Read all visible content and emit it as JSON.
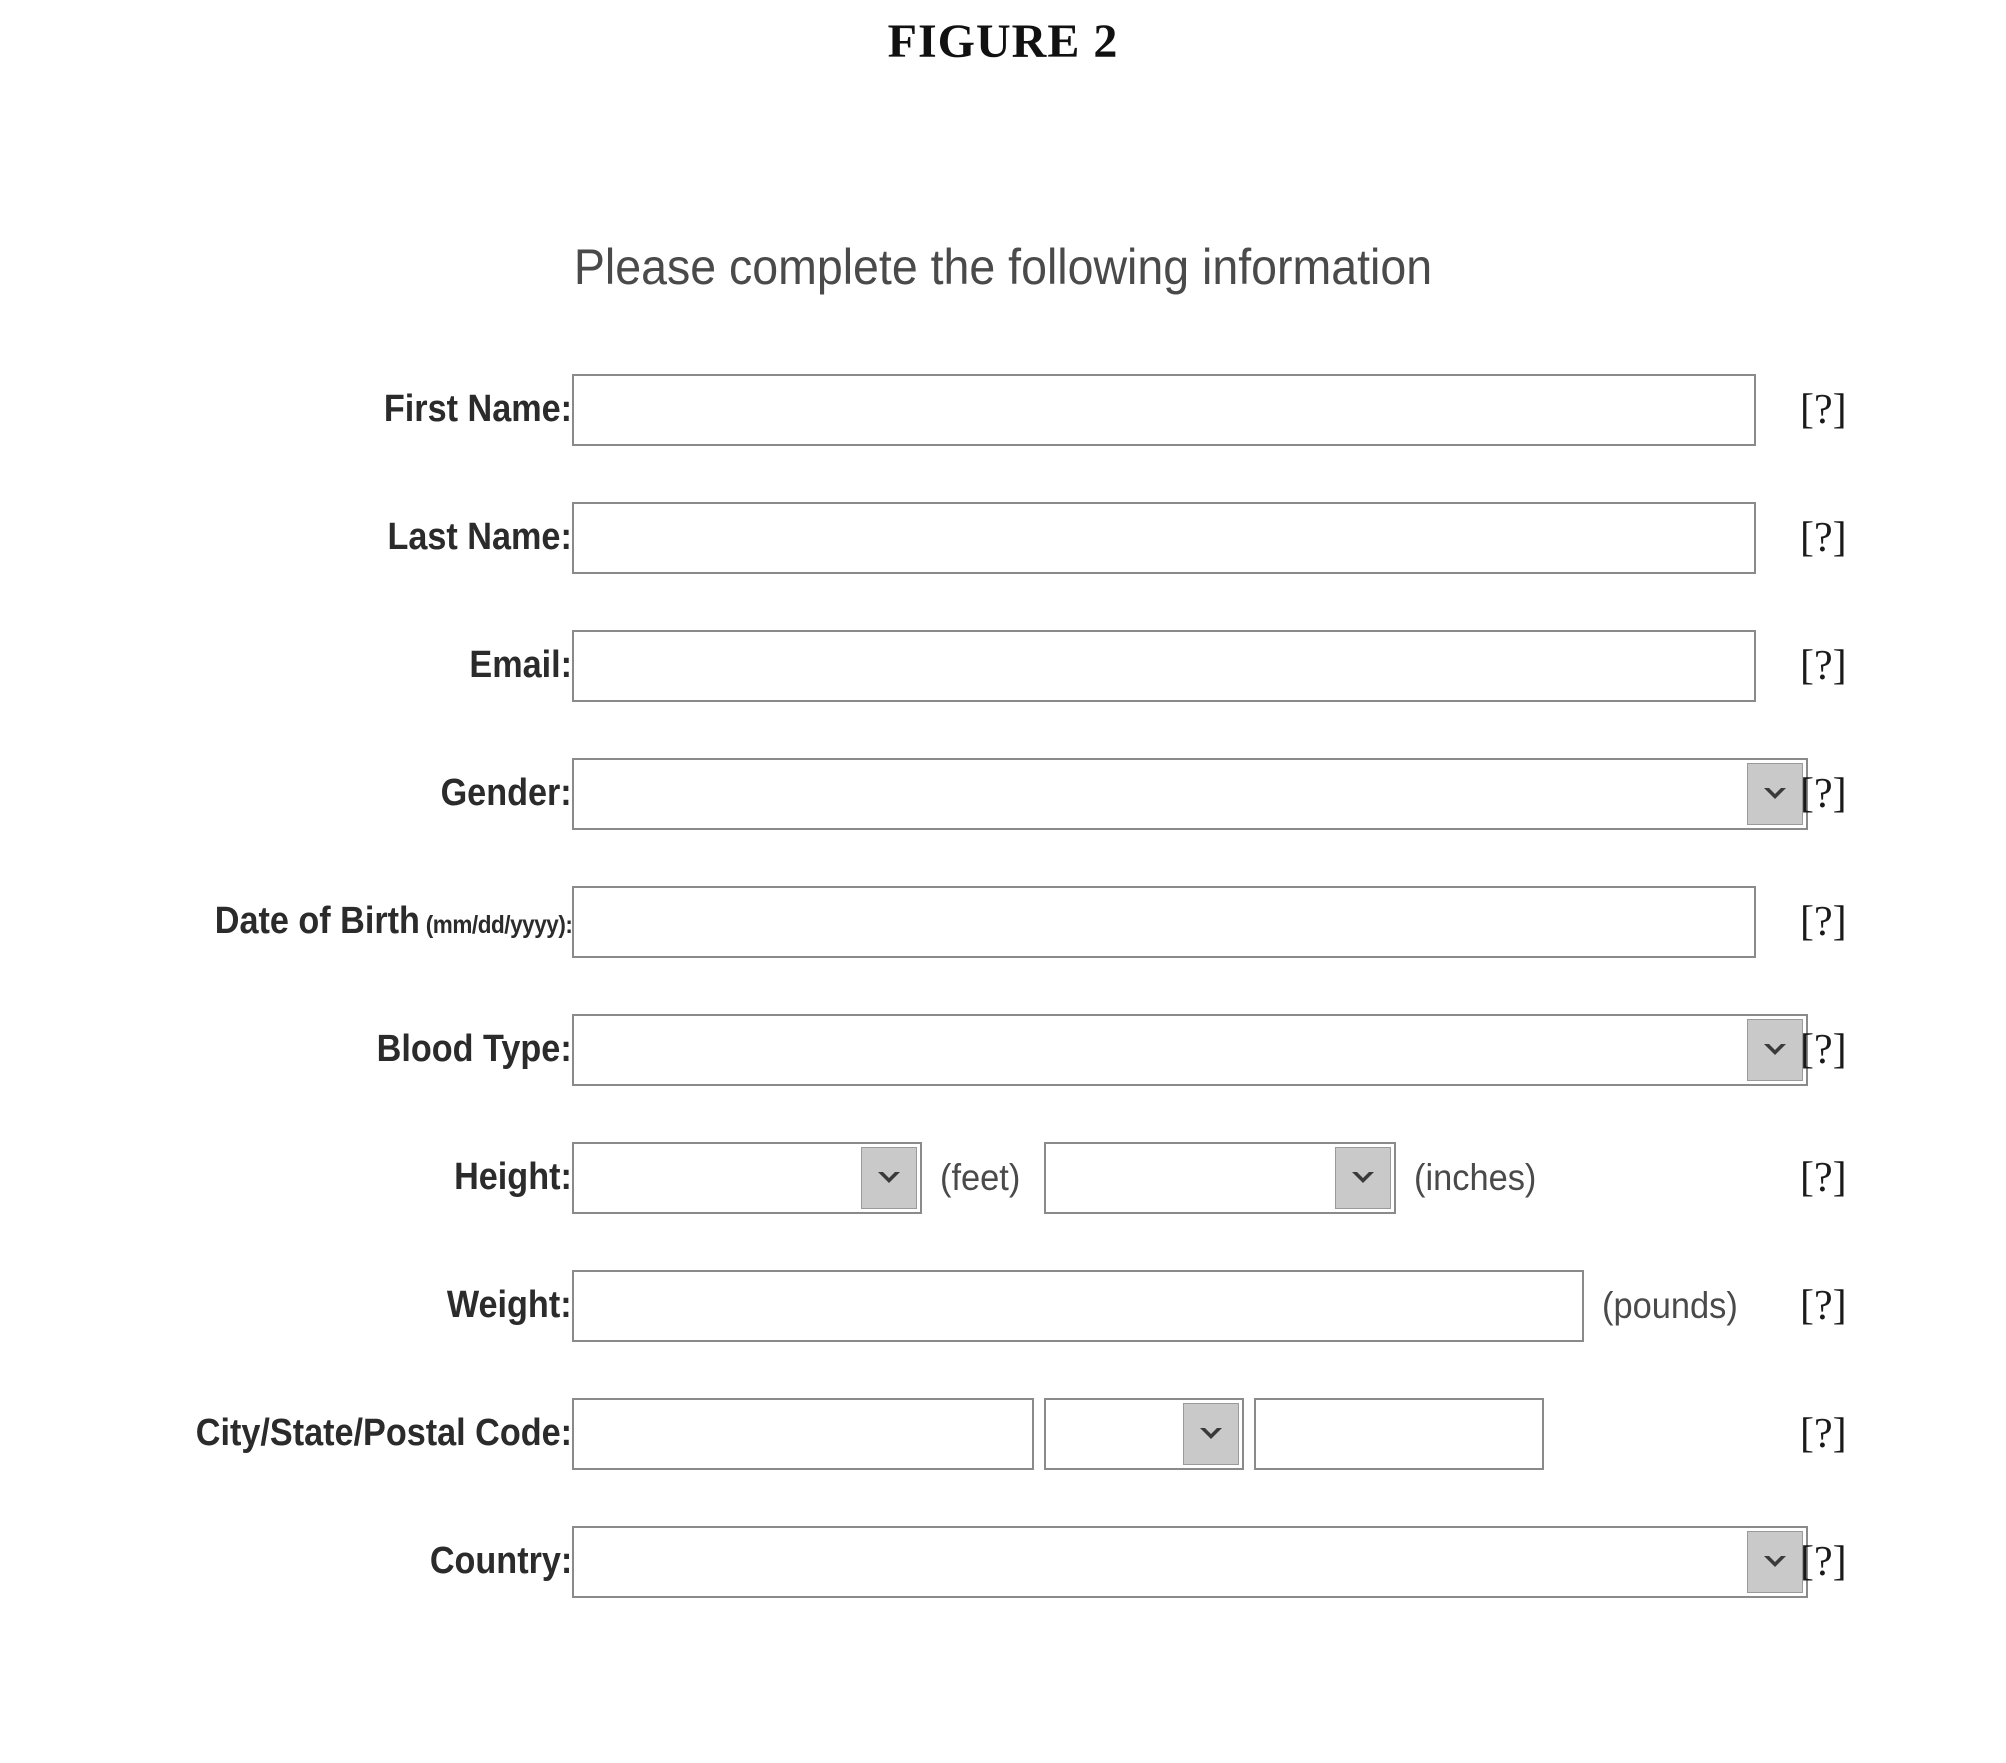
{
  "figure": {
    "title": "FIGURE 2"
  },
  "form": {
    "heading": "Please complete the following information",
    "help_marker": "[?]",
    "rows": [
      {
        "label": "First Name:",
        "sub_label": "",
        "help": "[?]",
        "fields": [
          {
            "type": "text",
            "value": "",
            "name": "first-name-input"
          }
        ]
      },
      {
        "label": "Last Name:",
        "sub_label": "",
        "help": "[?]",
        "fields": [
          {
            "type": "text",
            "value": "",
            "name": "last-name-input"
          }
        ]
      },
      {
        "label": "Email:",
        "sub_label": "",
        "help": "[?]",
        "fields": [
          {
            "type": "text",
            "value": "",
            "name": "email-input"
          }
        ]
      },
      {
        "label": "Gender:",
        "sub_label": "",
        "help": "[?]",
        "fields": [
          {
            "type": "select",
            "value": "",
            "name": "gender-select"
          }
        ]
      },
      {
        "label": "Date of Birth",
        "sub_label": " (mm/dd/yyyy):",
        "help": "[?]",
        "fields": [
          {
            "type": "text",
            "value": "",
            "name": "date-of-birth-input"
          }
        ]
      },
      {
        "label": "Blood Type:",
        "sub_label": "",
        "help": "[?]",
        "fields": [
          {
            "type": "select",
            "value": "",
            "name": "blood-type-select"
          }
        ]
      },
      {
        "label": "Height:",
        "sub_label": "",
        "help": "[?]",
        "fields": [
          {
            "type": "select",
            "value": "",
            "name": "height-feet-select",
            "unit": "(feet)"
          },
          {
            "type": "select",
            "value": "",
            "name": "height-inches-select",
            "unit": "(inches)"
          }
        ]
      },
      {
        "label": "Weight:",
        "sub_label": "",
        "help": "[?]",
        "fields": [
          {
            "type": "text",
            "value": "",
            "name": "weight-input",
            "unit": "(pounds)"
          }
        ]
      },
      {
        "label": "City/State/Postal Code:",
        "sub_label": "",
        "help": "[?]",
        "fields": [
          {
            "type": "text",
            "value": "",
            "name": "city-input"
          },
          {
            "type": "select",
            "value": "",
            "name": "state-select"
          },
          {
            "type": "text",
            "value": "",
            "name": "postal-code-input"
          }
        ]
      },
      {
        "label": "Country:",
        "sub_label": "",
        "help": "[?]",
        "fields": [
          {
            "type": "select",
            "value": "",
            "name": "country-select"
          }
        ]
      }
    ]
  },
  "icons": {
    "dropdown_arrow": "chevron-down-icon"
  },
  "colors": {
    "page_background": "#ffffff",
    "text": "#2b2b2b",
    "heading_text": "#4a4a4a",
    "field_border": "#8a8a8a",
    "arrow_button_fill": "#c9c9c9"
  }
}
